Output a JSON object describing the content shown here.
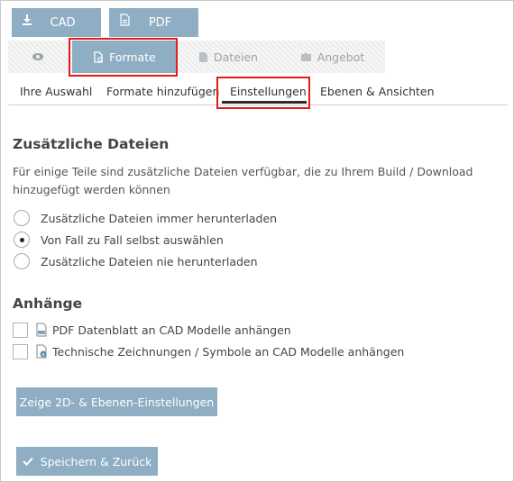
{
  "top_buttons": {
    "cad_label": "CAD",
    "pdf_label": "PDF"
  },
  "tabs": [
    {
      "label": "",
      "icon": "eye-icon"
    },
    {
      "label": "Formate",
      "icon": "file-format-icon",
      "active": true
    },
    {
      "label": "Dateien",
      "icon": "file-icon"
    },
    {
      "label": "Angebot",
      "icon": "quote-icon"
    }
  ],
  "subnav": [
    {
      "label": "Ihre Auswahl"
    },
    {
      "label": "Formate hinzufügen"
    },
    {
      "label": "Einstellungen",
      "active": true
    },
    {
      "label": "Ebenen & Ansichten"
    }
  ],
  "additional_files": {
    "heading": "Zusätzliche Dateien",
    "description": "Für einige Teile sind zusätzliche Dateien verfügbar, die zu Ihrem Build / Download hinzugefügt werden können",
    "options": [
      {
        "label": "Zusätzliche Dateien immer herunterladen",
        "selected": false
      },
      {
        "label": "Von Fall zu Fall selbst auswählen",
        "selected": true
      },
      {
        "label": "Zusätzliche Dateien nie herunterladen",
        "selected": false
      }
    ]
  },
  "attachments": {
    "heading": "Anhänge",
    "items": [
      {
        "label": "PDF Datenblatt an CAD Modelle anhängen",
        "checked": false,
        "icon": "pdf-file-icon"
      },
      {
        "label": "Technische Zeichnungen / Symbole an CAD Modelle anhängen",
        "checked": false,
        "icon": "info-file-icon"
      }
    ]
  },
  "buttons": {
    "show_2d": "Zeige 2D- & Ebenen-Einstellungen",
    "save_back": "Speichern & Zurück"
  },
  "colors": {
    "accent": "#8faec3",
    "highlight": "#e21b1b"
  }
}
